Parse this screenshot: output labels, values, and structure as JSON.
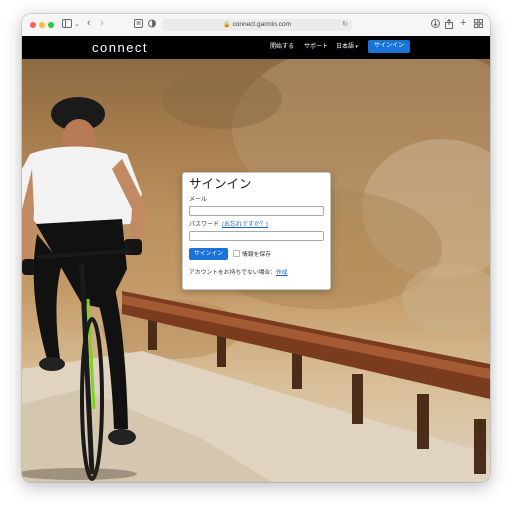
{
  "browser": {
    "url": "connect.garmin.com",
    "icons": {
      "sidebar": "sidebar-icon",
      "back": "chevron-left-icon",
      "forward": "chevron-right-icon",
      "privacy": "privacy-shield-icon",
      "reload": "reload-icon",
      "download": "download-icon",
      "share": "share-icon",
      "new_tab": "plus-icon",
      "tab_overview": "tab-grid-icon"
    }
  },
  "nav": {
    "logo": "connect",
    "links": [
      "開始する",
      "サポート",
      "日本語"
    ],
    "signin_label": "サインイン"
  },
  "login": {
    "title": "サインイン",
    "email_label": "メール",
    "password_label": "パスワード",
    "forgot_label": "(お忘れですか？)",
    "submit_label": "サインイン",
    "remember_label": "情報を保存",
    "no_account_label": "アカウントをお持ちでない場合：",
    "create_label": "作成"
  },
  "colors": {
    "nav_bg": "#000000",
    "accent": "#1a73d8",
    "link": "#1a66c4"
  }
}
